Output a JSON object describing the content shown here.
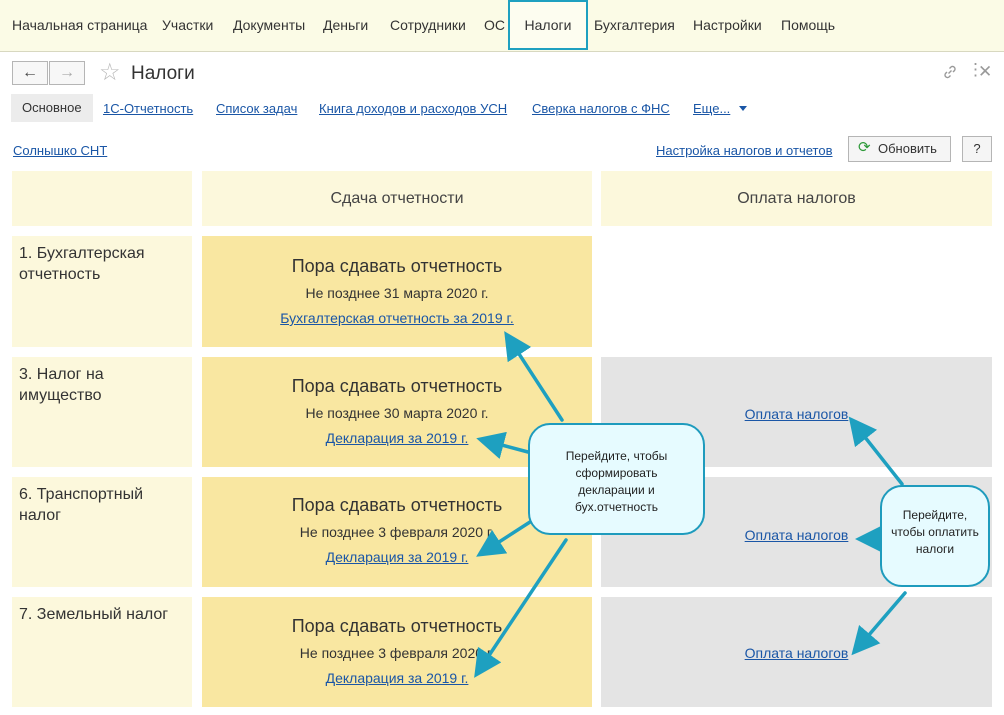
{
  "top_menu": [
    "Начальная страница",
    "Участки",
    "Документы",
    "Деньги",
    "Сотрудники",
    "ОС",
    "Налоги",
    "Бухгалтерия",
    "Настройки",
    "Помощь"
  ],
  "active_menu": "Налоги",
  "window": {
    "back_symbol": "←",
    "forward_symbol": "→",
    "title": "Налоги",
    "link_icon": "link-icon",
    "more_icon": "more-icon",
    "close_icon": "close-icon"
  },
  "subtabs": {
    "active": "Основное",
    "links": [
      "1С-Отчетность",
      "Список задач",
      "Книга доходов и расходов УСН",
      "Сверка налогов с ФНС"
    ],
    "more": "Еще..."
  },
  "org_link": "Солнышко СНТ",
  "settings_link": "Настройка налогов и отчетов",
  "refresh_label": "Обновить",
  "help_label": "?",
  "columns": {
    "reporting": "Сдача отчетности",
    "payment": "Оплата налогов"
  },
  "rows": [
    {
      "label": "1. Бухгалтерская отчетность",
      "report_title": "Пора сдавать отчетность",
      "report_date": "Не позднее 31 марта 2020 г.",
      "report_link": "Бухгалтерская отчетность за 2019 г.",
      "pay_link": ""
    },
    {
      "label": "3. Налог на имущество",
      "report_title": "Пора сдавать отчетность",
      "report_date": "Не позднее 30 марта 2020 г.",
      "report_link": "Декларация за 2019 г.",
      "pay_link": "Оплата налогов"
    },
    {
      "label": "6. Транспортный налог",
      "report_title": "Пора сдавать отчетность",
      "report_date": "Не позднее 3 февраля 2020 г.",
      "report_link": "Декларация за 2019 г.",
      "pay_link": "Оплата налогов"
    },
    {
      "label": "7. Земельный налог",
      "report_title": "Пора сдавать отчетность",
      "report_date": "Не позднее 3 февраля 2020 г.",
      "report_link": "Декларация за 2019 г.",
      "pay_link": "Оплата налогов"
    }
  ],
  "callouts": {
    "reporting": "Перейдите, чтобы сформировать декларации и бух.отчетность",
    "payment": "Перейдите, чтобы оплатить налоги"
  },
  "colors": {
    "accent": "#1ea0c0",
    "link": "#1a56a6",
    "report_bg": "#f9e7a1",
    "header_bg": "#fcf8dc",
    "pay_bg": "#e4e4e4"
  }
}
